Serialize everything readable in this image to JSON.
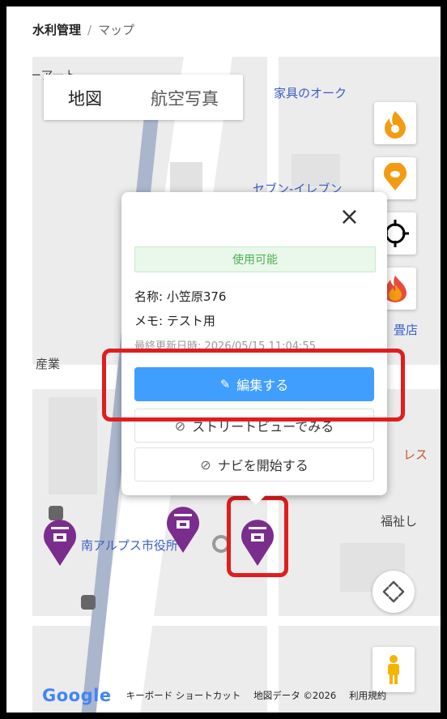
{
  "breadcrumb": {
    "root": "水利管理",
    "separator": "/",
    "current": "マップ"
  },
  "map_type": {
    "map": "地図",
    "satellite": "航空写真"
  },
  "map_labels": {
    "top_left": "ーアート",
    "furniture": "家具のオーク",
    "seven": "セブン-イレブン",
    "tatami": "畳店",
    "industry": "産業",
    "restaurant": "レス",
    "welfare": "福祉し",
    "city_hall": "南アルプス市役所"
  },
  "popup": {
    "status": "使用可能",
    "name_label": "名称: ",
    "name": "小笠原376",
    "memo_label": "メモ: ",
    "memo": "テスト用",
    "updated_label": "最終更新日時: ",
    "updated": "2026/05/15 11:04:55",
    "edit_button": "編集する",
    "streetview_button": "ストリートビューでみる",
    "navi_button": "ナビを開始する"
  },
  "footer": {
    "google": "Google",
    "shortcuts": "キーボード ショートカット",
    "map_data": "地図データ ©2026",
    "terms": "利用規約"
  },
  "colors": {
    "accent": "#409eff",
    "pin": "#7b2d8e",
    "highlight": "#e11d1d",
    "status_text": "#4caf50"
  }
}
